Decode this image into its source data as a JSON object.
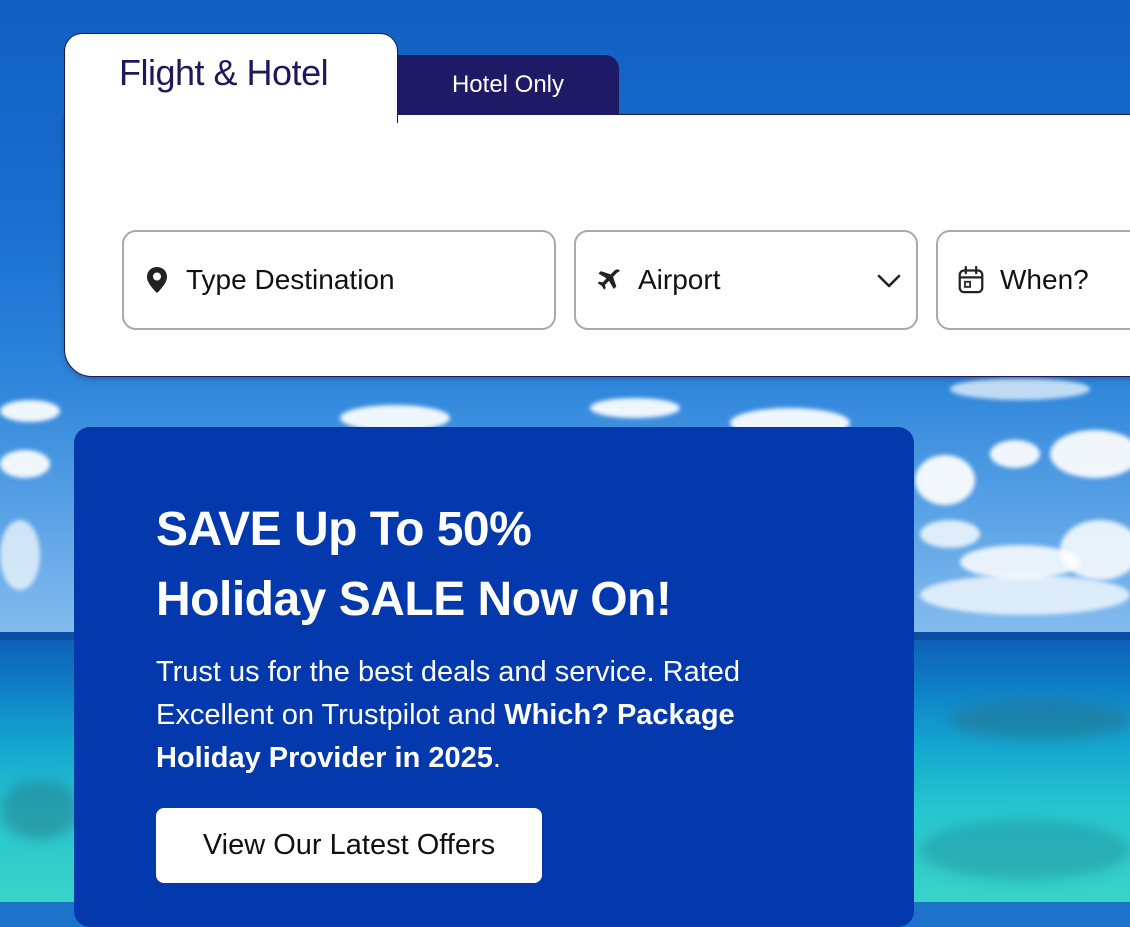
{
  "search": {
    "tabs": [
      {
        "label": "Flight & Hotel",
        "active": true
      },
      {
        "label": "Hotel Only",
        "active": false
      }
    ],
    "destination": {
      "placeholder": "Type Destination",
      "icon": "map-pin-icon"
    },
    "airport": {
      "placeholder": "Airport",
      "icon": "plane-icon",
      "dropdown_icon": "chevron-down-icon"
    },
    "when": {
      "placeholder": "When?",
      "icon": "calendar-icon"
    }
  },
  "promo": {
    "headline_line1": "SAVE Up To 50%",
    "headline_line2": "Holiday SALE Now On!",
    "body_text_1": "Trust us for the best deals and service. Rated Excellent on Trustpilot and ",
    "body_bold": "Which? Package Holiday Provider in 2025",
    "body_text_2": ".",
    "cta_label": "View Our Latest Offers"
  },
  "colors": {
    "navy": "#1d1a5a",
    "tab_inactive_bg": "#1f1a66",
    "promo_bg": "#0438ad",
    "field_border": "#a9a9a9"
  }
}
